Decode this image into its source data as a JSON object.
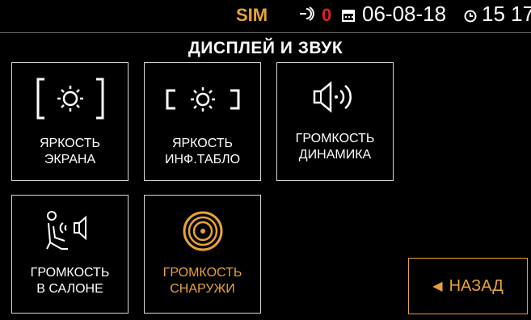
{
  "status": {
    "sim": "SIM",
    "signal_count": "0",
    "date": "06-08-18",
    "time": "15 17",
    "signal_icon": "signal-icon",
    "calendar_icon": "calendar-icon",
    "clock_icon": "clock-icon"
  },
  "title": "ДИСПЛЕЙ И ЗВУК",
  "tiles": [
    {
      "label": "ЯРКОСТЬ\nЭКРАНА",
      "icon": "screen-brightness-icon"
    },
    {
      "label": "ЯРКОСТЬ\nИНФ.ТАБЛО",
      "icon": "info-board-brightness-icon"
    },
    {
      "label": "ГРОМКОСТЬ\nДИНАМИКА",
      "icon": "speaker-volume-icon"
    },
    {
      "label": "ГРОМКОСТЬ\nВ САЛОНЕ",
      "icon": "cabin-volume-icon"
    },
    {
      "label": "ГРОМКОСТЬ\nСНАРУЖИ",
      "icon": "outside-volume-icon",
      "active": true
    }
  ],
  "back_label": "НАЗАД",
  "colors": {
    "accent": "#e8a238",
    "alert": "#e02020",
    "border": "#d8d8d8"
  }
}
